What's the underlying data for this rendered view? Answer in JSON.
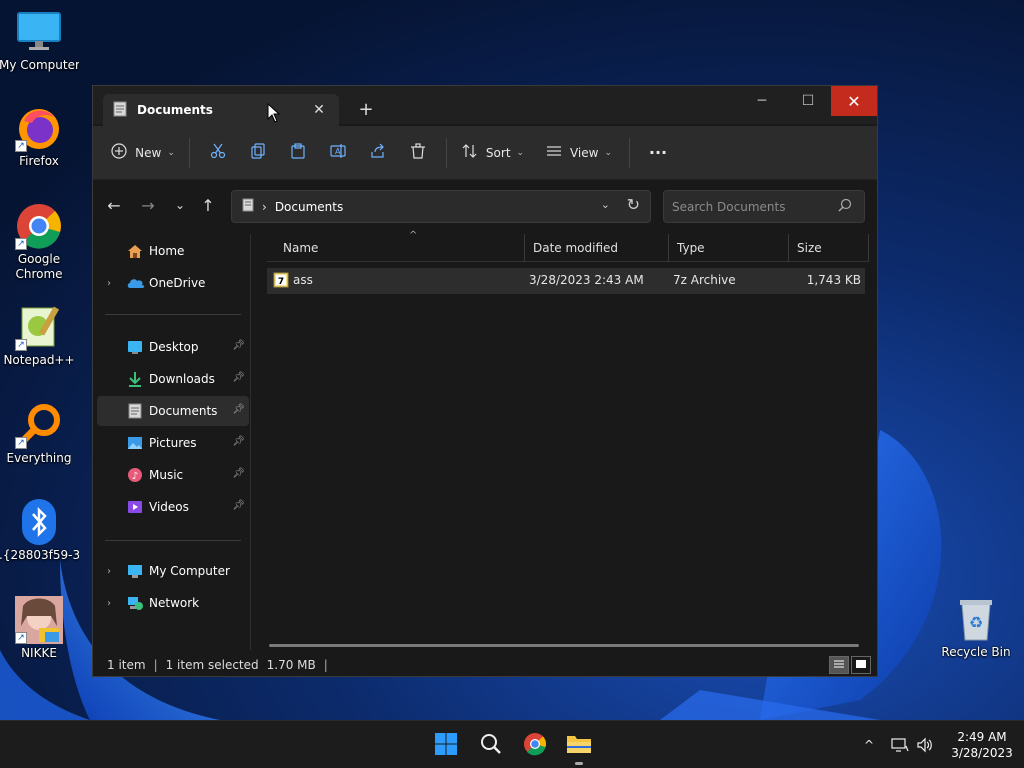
{
  "desktop": {
    "icons": [
      {
        "label": "My Computer"
      },
      {
        "label": "Firefox"
      },
      {
        "label": "Google Chrome"
      },
      {
        "label": "Notepad++"
      },
      {
        "label": "Everything"
      },
      {
        "label": ".{28803f59-3..."
      },
      {
        "label": "NIKKE"
      }
    ],
    "recycle_bin": "Recycle Bin"
  },
  "window": {
    "tab_title": "Documents",
    "tab_close": "✕",
    "new_tab": "+",
    "controls": {
      "minimize": "─",
      "maximize": "☐",
      "close": "✕"
    }
  },
  "toolbar": {
    "new_label": "New",
    "sort_label": "Sort",
    "view_label": "View",
    "more_label": "···"
  },
  "navigation": {
    "address_location": "Documents",
    "address_separator": "›",
    "search_placeholder": "Search Documents"
  },
  "sidebar": {
    "items": [
      {
        "label": "Home"
      },
      {
        "label": "OneDrive"
      },
      {
        "label": "Desktop"
      },
      {
        "label": "Downloads"
      },
      {
        "label": "Documents"
      },
      {
        "label": "Pictures"
      },
      {
        "label": "Music"
      },
      {
        "label": "Videos"
      },
      {
        "label": "My Computer"
      },
      {
        "label": "Network"
      }
    ]
  },
  "filelist": {
    "columns": [
      "Name",
      "Date modified",
      "Type",
      "Size"
    ],
    "rows": [
      {
        "name": "ass",
        "date": "3/28/2023 2:43 AM",
        "type": "7z Archive",
        "size": "1,743 KB"
      }
    ]
  },
  "status": {
    "count": "1 item",
    "selected": "1 item selected",
    "size": "1.70 MB"
  },
  "taskbar": {
    "time": "2:49 AM",
    "date": "3/28/2023"
  },
  "colors": {
    "close_button": "#c42b1c",
    "accent_blue": "#0078d4",
    "folder_yellow": "#f4c542"
  }
}
